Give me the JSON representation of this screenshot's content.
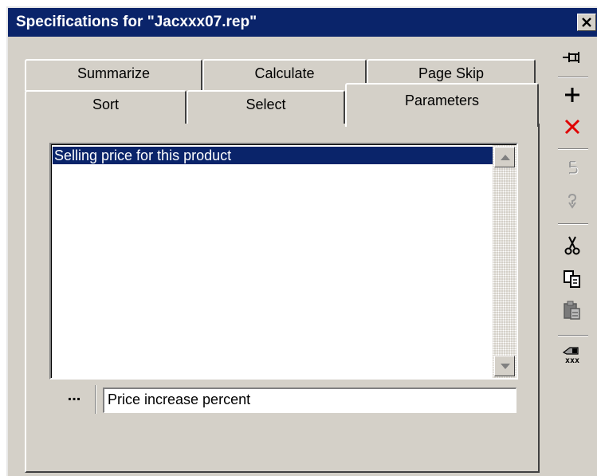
{
  "window": {
    "title": "Specifications for \"Jacxxx07.rep\""
  },
  "tabs": {
    "row_back": [
      {
        "label": "Summarize"
      },
      {
        "label": "Calculate"
      },
      {
        "label": "Page Skip"
      }
    ],
    "row_front": [
      {
        "label": "Sort"
      },
      {
        "label": "Select"
      },
      {
        "label": "Parameters",
        "active": true
      }
    ]
  },
  "parameters": {
    "list_items": [
      "Selling price for this product"
    ],
    "selected_index": 0,
    "description_value": "Price increase percent",
    "ellipsis_label": "..."
  },
  "toolbar": {
    "icons": [
      "pin-icon",
      "add-icon",
      "delete-icon",
      "undo-icon",
      "redo-icon",
      "cut-icon",
      "copy-icon",
      "paste-icon",
      "mask-icon"
    ],
    "mask_text": "xxx"
  },
  "colors": {
    "titlebar": "#0a246a",
    "face": "#d4d0c8",
    "selection": "#0a246a",
    "delete": "#e00000"
  }
}
